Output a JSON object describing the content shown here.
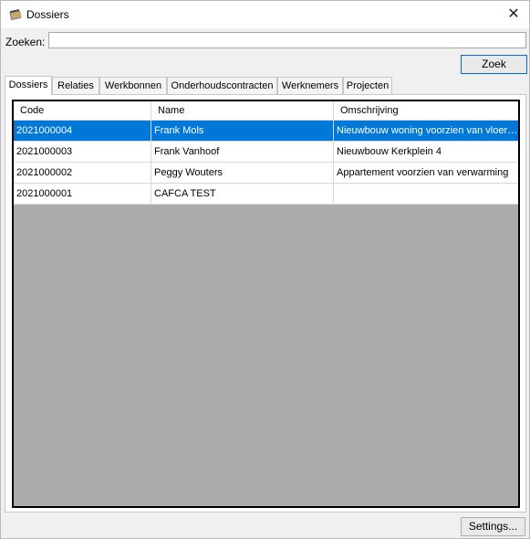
{
  "window": {
    "title": "Dossiers",
    "close_symbol": "✕",
    "icon": "books-icon"
  },
  "search": {
    "label": "Zoeken:",
    "value": "",
    "placeholder": ""
  },
  "buttons": {
    "zoek": "Zoek",
    "settings": "Settings..."
  },
  "tabs": [
    {
      "label": "Dossiers",
      "active": true
    },
    {
      "label": "Relaties"
    },
    {
      "label": "Werkbonnen"
    },
    {
      "label": "Onderhoudscontracten"
    },
    {
      "label": "Werknemers"
    },
    {
      "label": "Projecten"
    }
  ],
  "table": {
    "columns": [
      "Code",
      "Name",
      "Omschrijving"
    ],
    "rows": [
      {
        "code": "2021000004",
        "name": "Frank Mols",
        "omschrijving": "Nieuwbouw woning voorzien van vloerverwarming",
        "selected": true
      },
      {
        "code": "2021000003",
        "name": "Frank Vanhoof",
        "omschrijving": "Nieuwbouw Kerkplein 4"
      },
      {
        "code": "2021000002",
        "name": "Peggy Wouters",
        "omschrijving": "Appartement voorzien van verwarming"
      },
      {
        "code": "2021000001",
        "name": "CAFCA TEST",
        "omschrijving": ""
      }
    ]
  },
  "colors": {
    "selection": "#0078d7",
    "grid_background": "#ababab"
  }
}
